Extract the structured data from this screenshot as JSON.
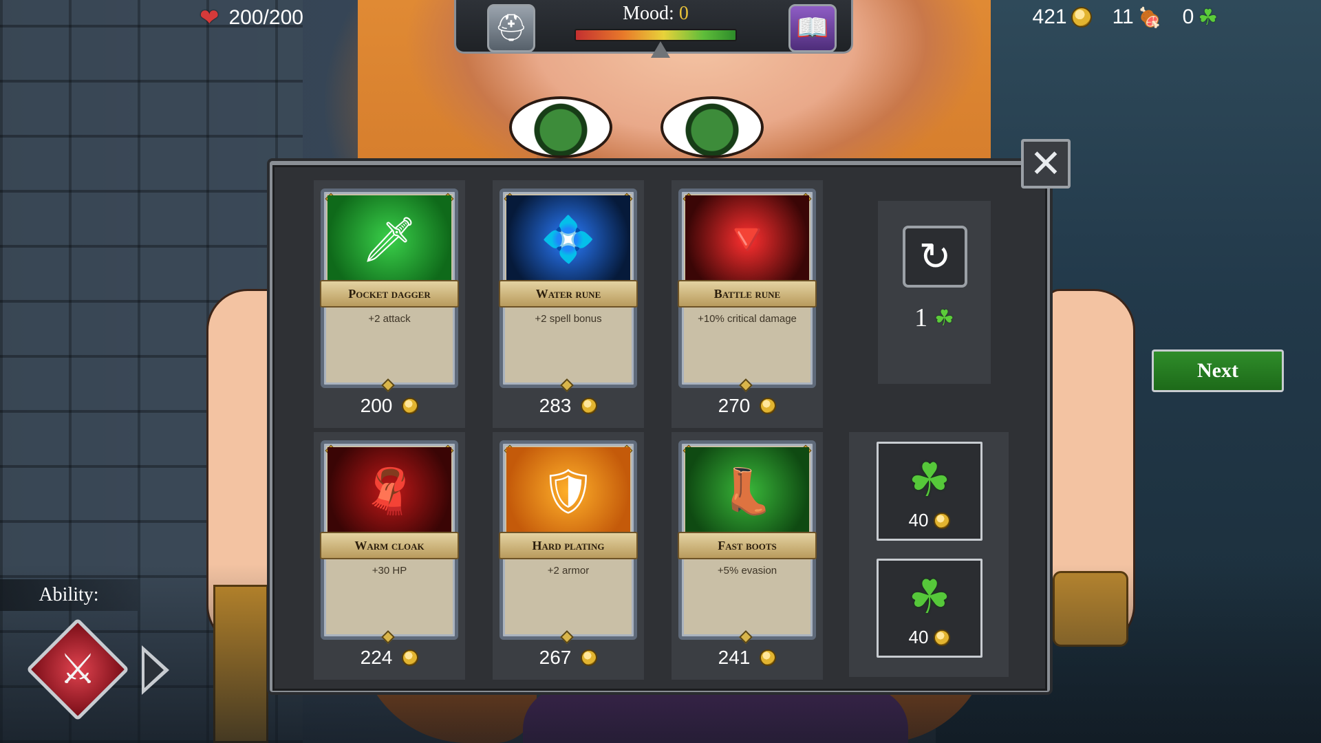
{
  "hud": {
    "hp": "200/200",
    "mood_label": "Mood:",
    "mood_value": "0",
    "gold": "421",
    "meat": "11",
    "clovers": "0"
  },
  "shop": {
    "items": [
      {
        "name": "Pocket dagger",
        "desc": "+2 attack",
        "price": "200",
        "icon": "dagger-icon"
      },
      {
        "name": "Water rune",
        "desc": "+2 spell bonus",
        "price": "283",
        "icon": "water-rune-icon"
      },
      {
        "name": "Battle rune",
        "desc": "+10% critical damage",
        "price": "270",
        "icon": "battle-rune-icon"
      },
      {
        "name": "Warm cloak",
        "desc": "+30 HP",
        "price": "224",
        "icon": "cloak-icon"
      },
      {
        "name": "Hard plating",
        "desc": "+2 armor",
        "price": "267",
        "icon": "plating-icon"
      },
      {
        "name": "Fast boots",
        "desc": "+5% evasion",
        "price": "241",
        "icon": "boots-icon"
      }
    ],
    "reroll_cost": "1",
    "clover_offers": [
      {
        "price": "40"
      },
      {
        "price": "40"
      }
    ]
  },
  "next_label": "Next",
  "ability_label": "Ability:",
  "colors": {
    "accent_green": "#2f8d2a",
    "gold": "#e2b430",
    "clover": "#56c83a"
  }
}
